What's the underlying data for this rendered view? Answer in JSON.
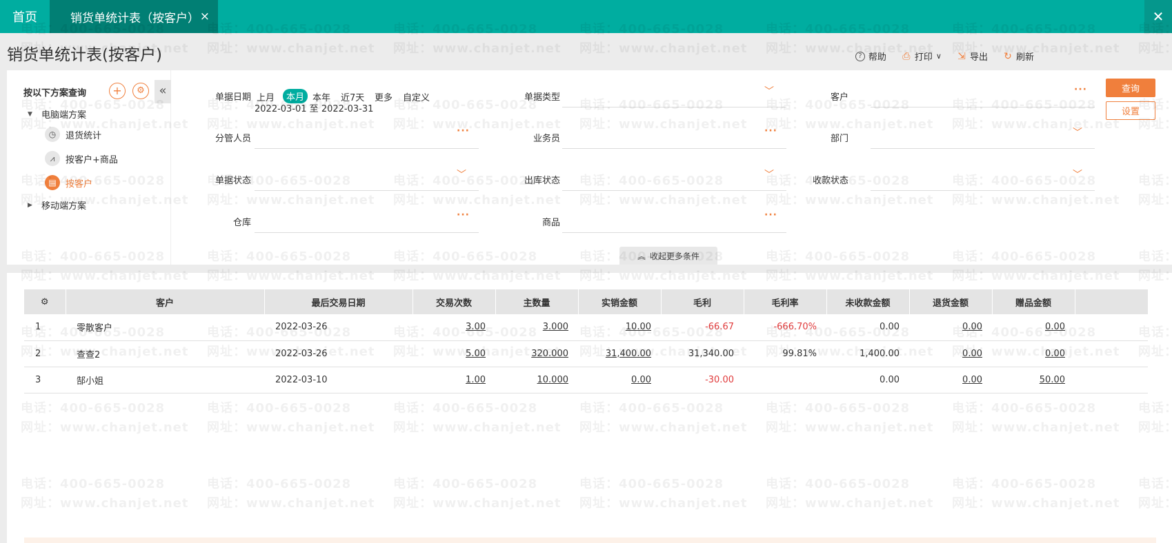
{
  "tabs": {
    "home": "首页",
    "active": "销货单统计表（按客户）",
    "close": "×",
    "window_close": "✕"
  },
  "page_title": "销货单统计表(按客户)",
  "toolbar": {
    "help": "帮助",
    "print": "打印",
    "print_caret": "∨",
    "export": "导出",
    "refresh": "刷新"
  },
  "sidebar": {
    "title": "按以下方案查询",
    "pc_group": "电脑端方案",
    "items": [
      {
        "label": "退货统计",
        "icon": "clock-icon"
      },
      {
        "label": "按客户+商品",
        "icon": "chart-icon"
      },
      {
        "label": "按客户",
        "icon": "table-icon"
      }
    ],
    "mobile_group": "移动端方案"
  },
  "filters": {
    "date_label": "单据日期",
    "date_options": [
      "上月",
      "本月",
      "本年",
      "近7天",
      "更多",
      "自定义"
    ],
    "date_range": "2022-03-01 至 2022-03-31",
    "doc_type": "单据类型",
    "customer": "客户",
    "manager": "分管人员",
    "salesperson": "业务员",
    "department": "部门",
    "doc_status": "单据状态",
    "outbound_status": "出库状态",
    "payment_status": "收款状态",
    "warehouse": "仓库",
    "product": "商品",
    "dots": "···",
    "chevron": "﹀"
  },
  "buttons": {
    "query": "查询",
    "setting": "设置",
    "collapse_more": "收起更多条件"
  },
  "table": {
    "headers": [
      "客户",
      "最后交易日期",
      "交易次数",
      "主数量",
      "实销金额",
      "毛利",
      "毛利率",
      "未收款金额",
      "退货金额",
      "赠品金额"
    ],
    "rows": [
      {
        "idx": "1",
        "customer": "零散客户",
        "date": "2022-03-26",
        "count": "3.00",
        "qty": "3.000",
        "amount": "10.00",
        "profit": "-66.67",
        "rate": "-666.70%",
        "unpaid": "0.00",
        "returns": "0.00",
        "gift": "0.00"
      },
      {
        "idx": "2",
        "customer": "查查2",
        "date": "2022-03-26",
        "count": "5.00",
        "qty": "320.000",
        "amount": "31,400.00",
        "profit": "31,340.00",
        "rate": "99.81%",
        "unpaid": "1,400.00",
        "returns": "0.00",
        "gift": "0.00"
      },
      {
        "idx": "3",
        "customer": "郜小姐",
        "date": "2022-03-10",
        "count": "1.00",
        "qty": "10.000",
        "amount": "0.00",
        "profit": "-30.00",
        "rate": "",
        "unpaid": "0.00",
        "returns": "0.00",
        "gift": "50.00"
      }
    ]
  },
  "watermark": {
    "phone": "电话：400-665-0028",
    "site": "网址：www.chanjet.net"
  },
  "colors": {
    "teal": "#00ada0",
    "dark_teal": "#017f74",
    "orange": "#f07f3c",
    "negative": "#e0393a"
  }
}
